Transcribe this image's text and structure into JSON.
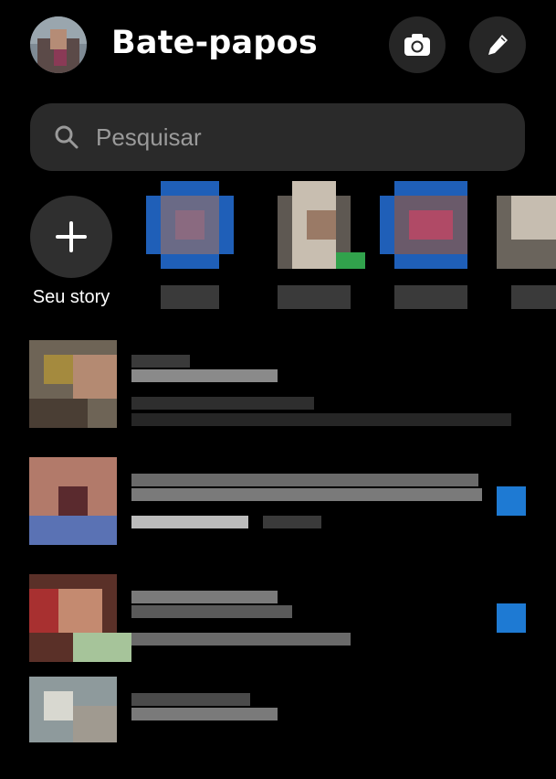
{
  "header": {
    "title": "Bate-papos",
    "camera_icon": "camera-icon",
    "compose_icon": "pencil-icon"
  },
  "search": {
    "placeholder": "Pesquisar",
    "value": ""
  },
  "stories": {
    "add_label": "Seu story"
  },
  "colors": {
    "background": "#000000",
    "search_bg": "#2a2a2a",
    "button_bg": "#262626",
    "unread": "#1e7ad3",
    "online": "#31a24c"
  }
}
